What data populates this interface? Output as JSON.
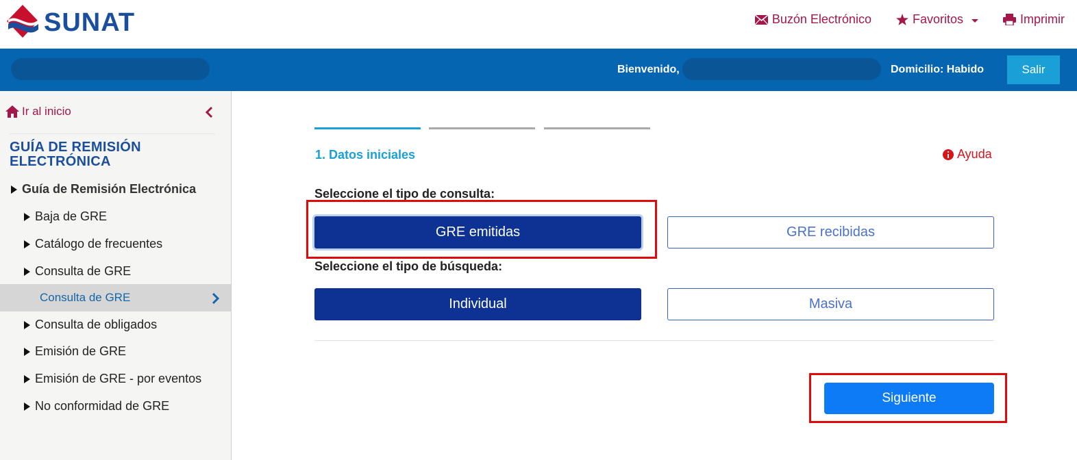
{
  "header": {
    "logo_text": "SUNAT",
    "links": [
      {
        "label": "Buzón Electrónico",
        "icon": "envelope-icon"
      },
      {
        "label": "Favoritos",
        "icon": "star-icon"
      },
      {
        "label": "Imprimir",
        "icon": "printer-icon"
      }
    ]
  },
  "userbar": {
    "welcome_label": "Bienvenido,",
    "domicilio": "Domicilio: Habido",
    "logout_label": "Salir"
  },
  "sidebar": {
    "home_label": "Ir al inicio",
    "section_title": "GUÍA DE REMISIÓN ELECTRÓNICA",
    "group_label": "Guía de Remisión Electrónica",
    "items": [
      "Baja de GRE",
      "Catálogo de frecuentes",
      "Consulta de GRE",
      "Consulta de obligados",
      "Emisión de GRE",
      "Emisión de GRE - por eventos",
      "No conformidad de GRE"
    ],
    "active_item": "Consulta de GRE"
  },
  "wizard": {
    "step_title": "1. Datos iniciales",
    "help_label": "Ayuda",
    "consulta_label": "Seleccione el tipo de consulta:",
    "consulta_options": [
      "GRE emitidas",
      "GRE recibidas"
    ],
    "consulta_selected": "GRE emitidas",
    "busqueda_label": "Seleccione el tipo de búsqueda:",
    "busqueda_options": [
      "Individual",
      "Masiva"
    ],
    "busqueda_selected": "Individual",
    "next_label": "Siguiente"
  },
  "colors": {
    "brand_blue": "#0565b0",
    "brand_red": "#a3174a",
    "primary_button": "#0e3293",
    "next_button": "#0d7bf6",
    "step_active": "#1aa0d6",
    "highlight_box": "#e00a0a"
  }
}
